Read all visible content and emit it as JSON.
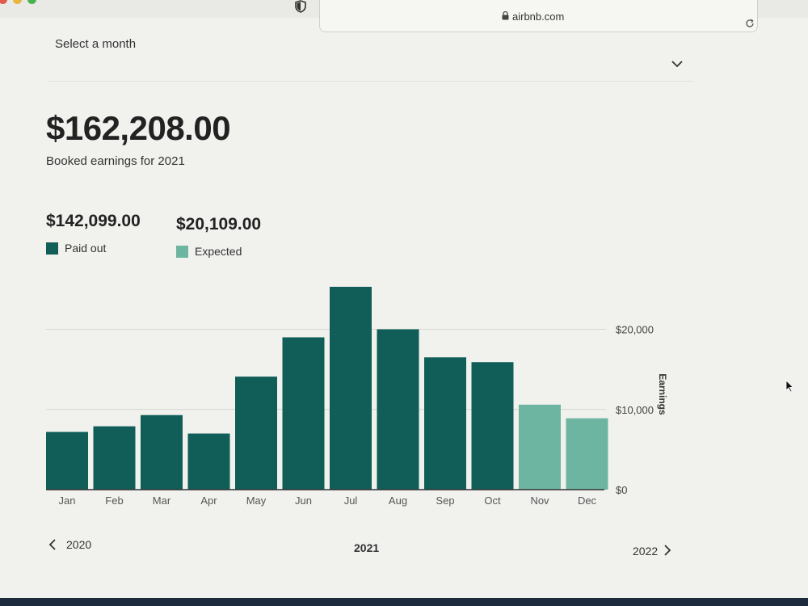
{
  "browser": {
    "url": "airbnb.com"
  },
  "filter": {
    "month_label": "Select a month"
  },
  "summary": {
    "total": "$162,208.00",
    "caption": "Booked earnings for 2021",
    "paid_out_value": "$142,099.00",
    "paid_out_label": "Paid out",
    "expected_value": "$20,109.00",
    "expected_label": "Expected"
  },
  "colors": {
    "paid_out": "#115e59",
    "expected": "#6db5a1"
  },
  "chart_data": {
    "type": "bar",
    "categories": [
      "Jan",
      "Feb",
      "Mar",
      "Apr",
      "May",
      "Jun",
      "Jul",
      "Aug",
      "Sep",
      "Oct",
      "Nov",
      "Dec"
    ],
    "series": [
      {
        "name": "Paid out",
        "values": [
          7200,
          7900,
          9300,
          7000,
          14100,
          19000,
          25300,
          20000,
          16500,
          15900,
          0,
          0
        ]
      },
      {
        "name": "Expected",
        "values": [
          0,
          0,
          0,
          0,
          0,
          0,
          0,
          0,
          0,
          0,
          10600,
          8900
        ]
      }
    ],
    "ylabel": "Earnings",
    "yticks": [
      "$0",
      "$10,000",
      "$20,000"
    ],
    "ylim": [
      0,
      26000
    ],
    "stacked": true
  },
  "year_nav": {
    "prev": "2020",
    "current": "2021",
    "next": "2022"
  }
}
